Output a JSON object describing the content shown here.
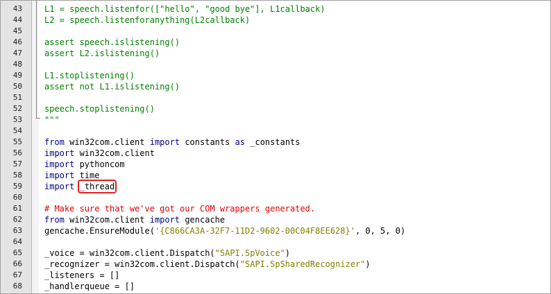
{
  "lines": [
    {
      "n": "43",
      "text": "L1 = speech.listenfor([\"hello\", \"good bye\"], L1callback)",
      "style": "def"
    },
    {
      "n": "44",
      "text": "L2 = speech.listenforanything(L2callback)",
      "style": "def"
    },
    {
      "n": "45",
      "text": "",
      "style": "def"
    },
    {
      "n": "46",
      "text": "assert speech.islistening()",
      "style": "def"
    },
    {
      "n": "47",
      "text": "assert L2.islistening()",
      "style": "def"
    },
    {
      "n": "48",
      "text": "",
      "style": "def"
    },
    {
      "n": "49",
      "text": "L1.stoplistening()",
      "style": "def"
    },
    {
      "n": "50",
      "text": "assert not L1.islistening()",
      "style": "def"
    },
    {
      "n": "51",
      "text": "",
      "style": "def"
    },
    {
      "n": "52",
      "text": "speech.stoplistening()",
      "style": "def"
    },
    {
      "n": "53",
      "text": "\"\"\"",
      "style": "def"
    },
    {
      "n": "54",
      "text": "",
      "style": "plain"
    },
    {
      "n": "55",
      "segments": [
        {
          "t": "from",
          "c": "kw"
        },
        {
          "t": " win32com.client ",
          "c": ""
        },
        {
          "t": "import",
          "c": "kw"
        },
        {
          "t": " constants ",
          "c": ""
        },
        {
          "t": "as",
          "c": "kw"
        },
        {
          "t": " _constants",
          "c": ""
        }
      ]
    },
    {
      "n": "56",
      "segments": [
        {
          "t": "import",
          "c": "kw"
        },
        {
          "t": " win32com.client",
          "c": ""
        }
      ]
    },
    {
      "n": "57",
      "segments": [
        {
          "t": "import",
          "c": "kw"
        },
        {
          "t": " pythoncom",
          "c": ""
        }
      ]
    },
    {
      "n": "58",
      "segments": [
        {
          "t": "import",
          "c": "kw"
        },
        {
          "t": " time",
          "c": ""
        }
      ]
    },
    {
      "n": "59",
      "segments": [
        {
          "t": "import",
          "c": "kw"
        },
        {
          "t": " ",
          "c": ""
        },
        {
          "t": "_thread",
          "c": "",
          "highlight": true
        }
      ]
    },
    {
      "n": "60",
      "text": "",
      "style": "plain"
    },
    {
      "n": "61",
      "text": "# Make sure that we've got our COM wrappers generated.",
      "style": "cm"
    },
    {
      "n": "62",
      "segments": [
        {
          "t": "from",
          "c": "kw"
        },
        {
          "t": " win32com.client ",
          "c": ""
        },
        {
          "t": "import",
          "c": "kw"
        },
        {
          "t": " gencache",
          "c": ""
        }
      ]
    },
    {
      "n": "63",
      "segments": [
        {
          "t": "gencache.EnsureModule(",
          "c": ""
        },
        {
          "t": "'{C866CA3A-32F7-11D2-9602-00C04F8EE628}'",
          "c": "str"
        },
        {
          "t": ", 0, 5, 0)",
          "c": ""
        }
      ]
    },
    {
      "n": "64",
      "text": "",
      "style": "plain"
    },
    {
      "n": "65",
      "segments": [
        {
          "t": "_voice = win32com.client.Dispatch(",
          "c": ""
        },
        {
          "t": "\"SAPI.SpVoice\"",
          "c": "str"
        },
        {
          "t": ")",
          "c": ""
        }
      ]
    },
    {
      "n": "66",
      "segments": [
        {
          "t": "_recognizer = win32com.client.Dispatch(",
          "c": ""
        },
        {
          "t": "\"SAPI.SpSharedRecognizer\"",
          "c": "str"
        },
        {
          "t": ")",
          "c": ""
        }
      ]
    },
    {
      "n": "67",
      "text": "_listeners = []",
      "style": "plain"
    },
    {
      "n": "68",
      "text": "_handlerqueue = []",
      "style": "plain"
    }
  ]
}
